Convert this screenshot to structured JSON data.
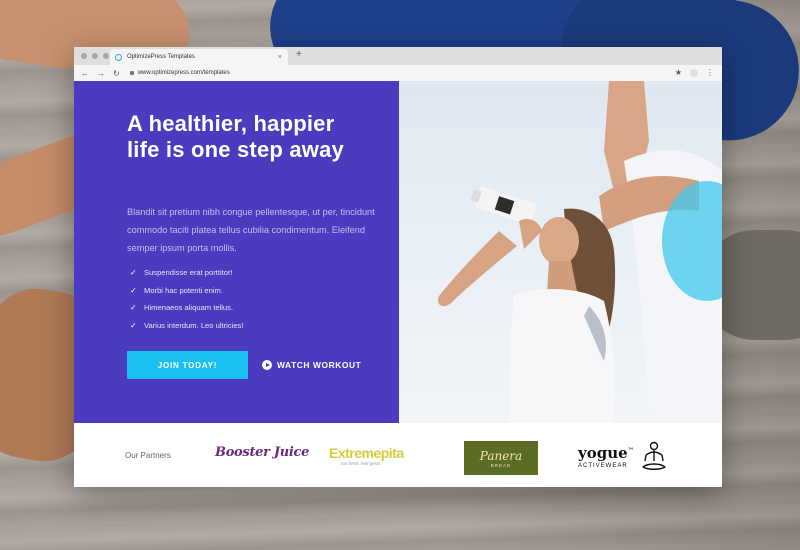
{
  "browser": {
    "tab_title": "OptimizePress Templates",
    "tab_close": "×",
    "new_tab": "+",
    "url": "www.optimizepress.com/templates",
    "nav": {
      "back": "←",
      "forward": "→",
      "reload": "↻"
    },
    "star": "★",
    "menu": "⋮"
  },
  "hero": {
    "headline": "A healthier, happier life is one step away",
    "intro": "Blandit sit pretium nibh congue pellentesque, ut per, tincidunt commodo taciti platea tellus cubilia condimentum. Eleifend semper ipsum porta mollis.",
    "checklist": [
      "Suspendisse erat porttitor!",
      "Morbi hac potenti enim.",
      "Himenaeos aliquam tellus.",
      "Varius interdum. Leo ultricies!"
    ],
    "check_glyph": "✓",
    "cta_label": "JOIN TODAY!",
    "watch_label": "WATCH WORKOUT"
  },
  "partners": {
    "label": "Our Partners",
    "logos": {
      "booster": "Booster Juice",
      "extreme_big": "Extremepita",
      "extreme_small": "eat fresh. feel great.",
      "panera_name": "Panera",
      "panera_sub": "BREAD",
      "yogue_big": "yogue",
      "yogue_tm": "™",
      "yogue_small": "ACTIVEWEAR"
    }
  },
  "colors": {
    "hero_bg": "#4a3bbf",
    "cta_bg": "#18c0ef",
    "accent_teal": "#40c8ee"
  },
  "icons": [
    "back-arrow-icon",
    "forward-arrow-icon",
    "reload-icon",
    "lock-icon",
    "star-icon",
    "profile-icon",
    "menu-dots-icon",
    "check-icon",
    "play-circle-icon",
    "yoga-meditation-icon"
  ]
}
